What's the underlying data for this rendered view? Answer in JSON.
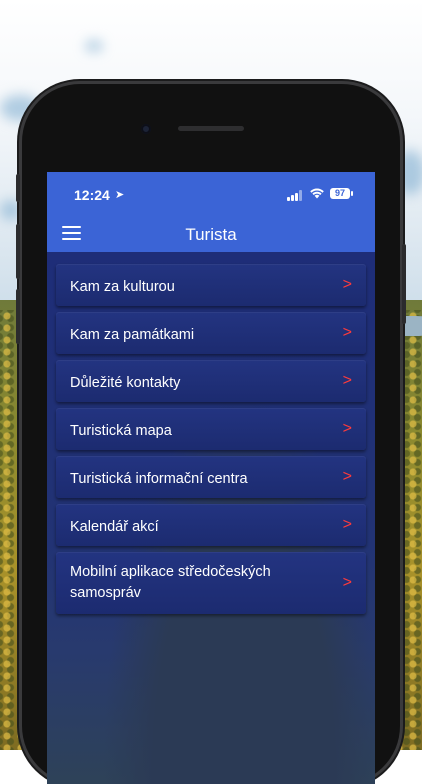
{
  "status_bar": {
    "time": "12:24",
    "battery": "97"
  },
  "app_bar": {
    "title": "Turista"
  },
  "menu": {
    "items": [
      {
        "label": "Kam za kulturou"
      },
      {
        "label": "Kam za památkami"
      },
      {
        "label": "Důležité kontakty"
      },
      {
        "label": "Turistická mapa"
      },
      {
        "label": "Turistická informační centra"
      },
      {
        "label": "Kalendář akcí"
      },
      {
        "label": "Mobilní aplikace středočeských samospráv"
      }
    ]
  },
  "icons": {
    "menu": "hamburger-icon",
    "chevron": "chevron-right-icon",
    "location": "location-arrow-icon",
    "wifi": "wifi-icon",
    "signal": "signal-icon",
    "battery": "battery-icon"
  },
  "colors": {
    "app_bar": "#3b64d6",
    "menu_item_bg": "#1f2f7a",
    "chevron": "#ff3b3b"
  }
}
